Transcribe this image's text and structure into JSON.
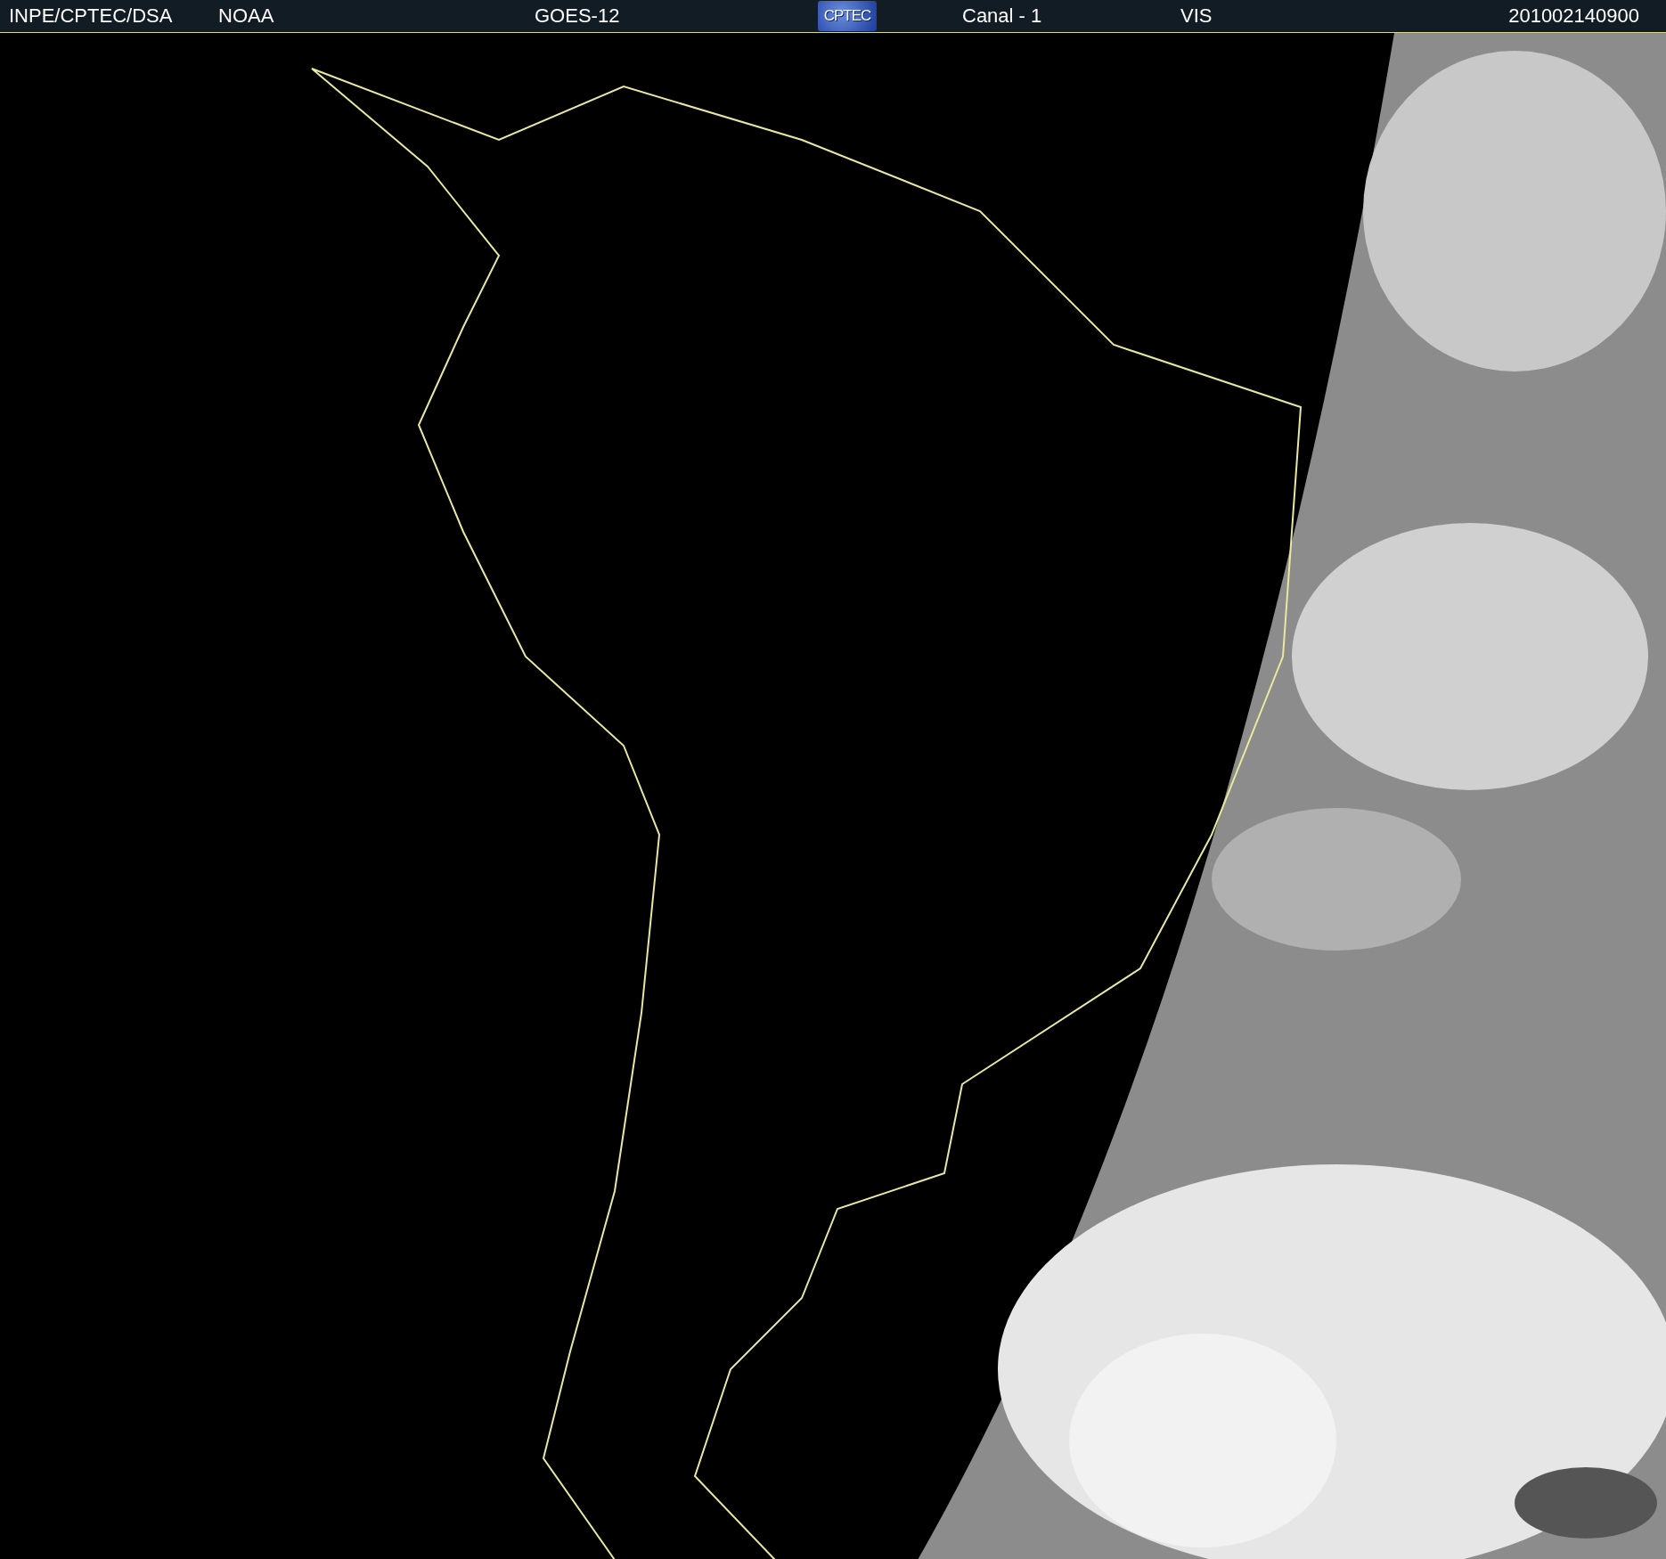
{
  "header": {
    "source": "INPE/CPTEC/DSA",
    "agency": "NOAA",
    "satellite": "GOES-12",
    "logo": "CPTEC",
    "channel": "Canal - 1",
    "band": "VIS",
    "timestamp": "201002140900"
  }
}
